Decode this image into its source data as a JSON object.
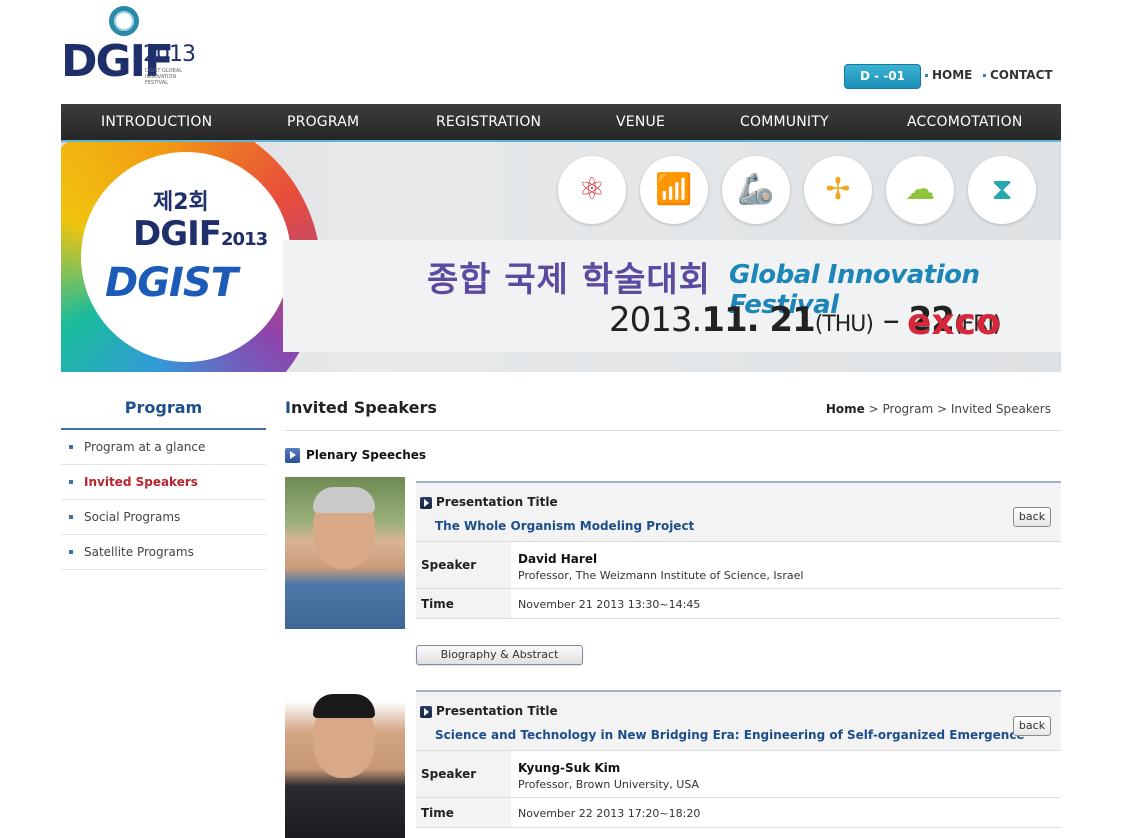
{
  "header": {
    "logo": {
      "word": "DGIF",
      "year": "2013",
      "tagline": "DGIST GLOBAL INNOVATION FESTIVAL"
    },
    "dday": "D - -01",
    "links": [
      {
        "label": "HOME"
      },
      {
        "label": "CONTACT"
      }
    ]
  },
  "nav": {
    "items": [
      {
        "label": "INTRODUCTION"
      },
      {
        "label": "PROGRAM"
      },
      {
        "label": "REGISTRATION"
      },
      {
        "label": "VENUE"
      },
      {
        "label": "COMMUNITY"
      },
      {
        "label": "ACCOMOTATION"
      }
    ]
  },
  "banner": {
    "edition": "제2회",
    "logo_word": "DGIF",
    "logo_year": "2013",
    "dgist": "DGIST",
    "title_kor": "종합 국제 학술대회",
    "title_eng": "Global Innovation Festival",
    "date_year": "2013.",
    "date_start": "11. 21",
    "date_start_day": "(THU)",
    "date_sep": " – ",
    "date_end": "22",
    "date_end_day": "(FRI)",
    "venue": "exco",
    "icons": [
      {
        "name": "atom-icon",
        "glyph": "⚛",
        "color": "#d9343f"
      },
      {
        "name": "antenna-icon",
        "glyph": "📶",
        "color": "#f08a1c"
      },
      {
        "name": "robot-arm-icon",
        "glyph": "🦾",
        "color": "#7a4aa0"
      },
      {
        "name": "wind-turbine-icon",
        "glyph": "✢",
        "color": "#f0a81c"
      },
      {
        "name": "brain-icon",
        "glyph": "☁",
        "color": "#8fc33c"
      },
      {
        "name": "dna-icon",
        "glyph": "⧗",
        "color": "#27a7b0"
      }
    ]
  },
  "sidebar": {
    "title": "Program",
    "items": [
      {
        "label": "Program at a glance",
        "active": false
      },
      {
        "label": "Invited Speakers",
        "active": true
      },
      {
        "label": "Social Programs",
        "active": false
      },
      {
        "label": "Satellite Programs",
        "active": false
      }
    ]
  },
  "content": {
    "page_title_first": "I",
    "page_title_rest": "nvited Speakers",
    "breadcrumb": {
      "home": "Home",
      "sep1": " > ",
      "level1": "Program",
      "sep2": " > ",
      "level2": "Invited Speakers"
    },
    "section": "Plenary Speeches",
    "labels": {
      "presentation_title": "Presentation Title",
      "speaker": "Speaker",
      "time": "Time",
      "back": "back",
      "bio": "Biography & Abstract"
    },
    "speakers": [
      {
        "title": "The Whole Organism Modeling Project",
        "name": "David Harel",
        "affiliation": "Professor, The Weizmann Institute of Science, Israel",
        "time": "November 21 2013 13:30~14:45"
      },
      {
        "title": "Science and Technology in New Bridging Era: Engineering of Self-organized Emergence",
        "name": "Kyung-Suk Kim",
        "affiliation": "Professor, Brown University, USA",
        "time": "November 22 2013 17:20~18:20"
      }
    ]
  }
}
